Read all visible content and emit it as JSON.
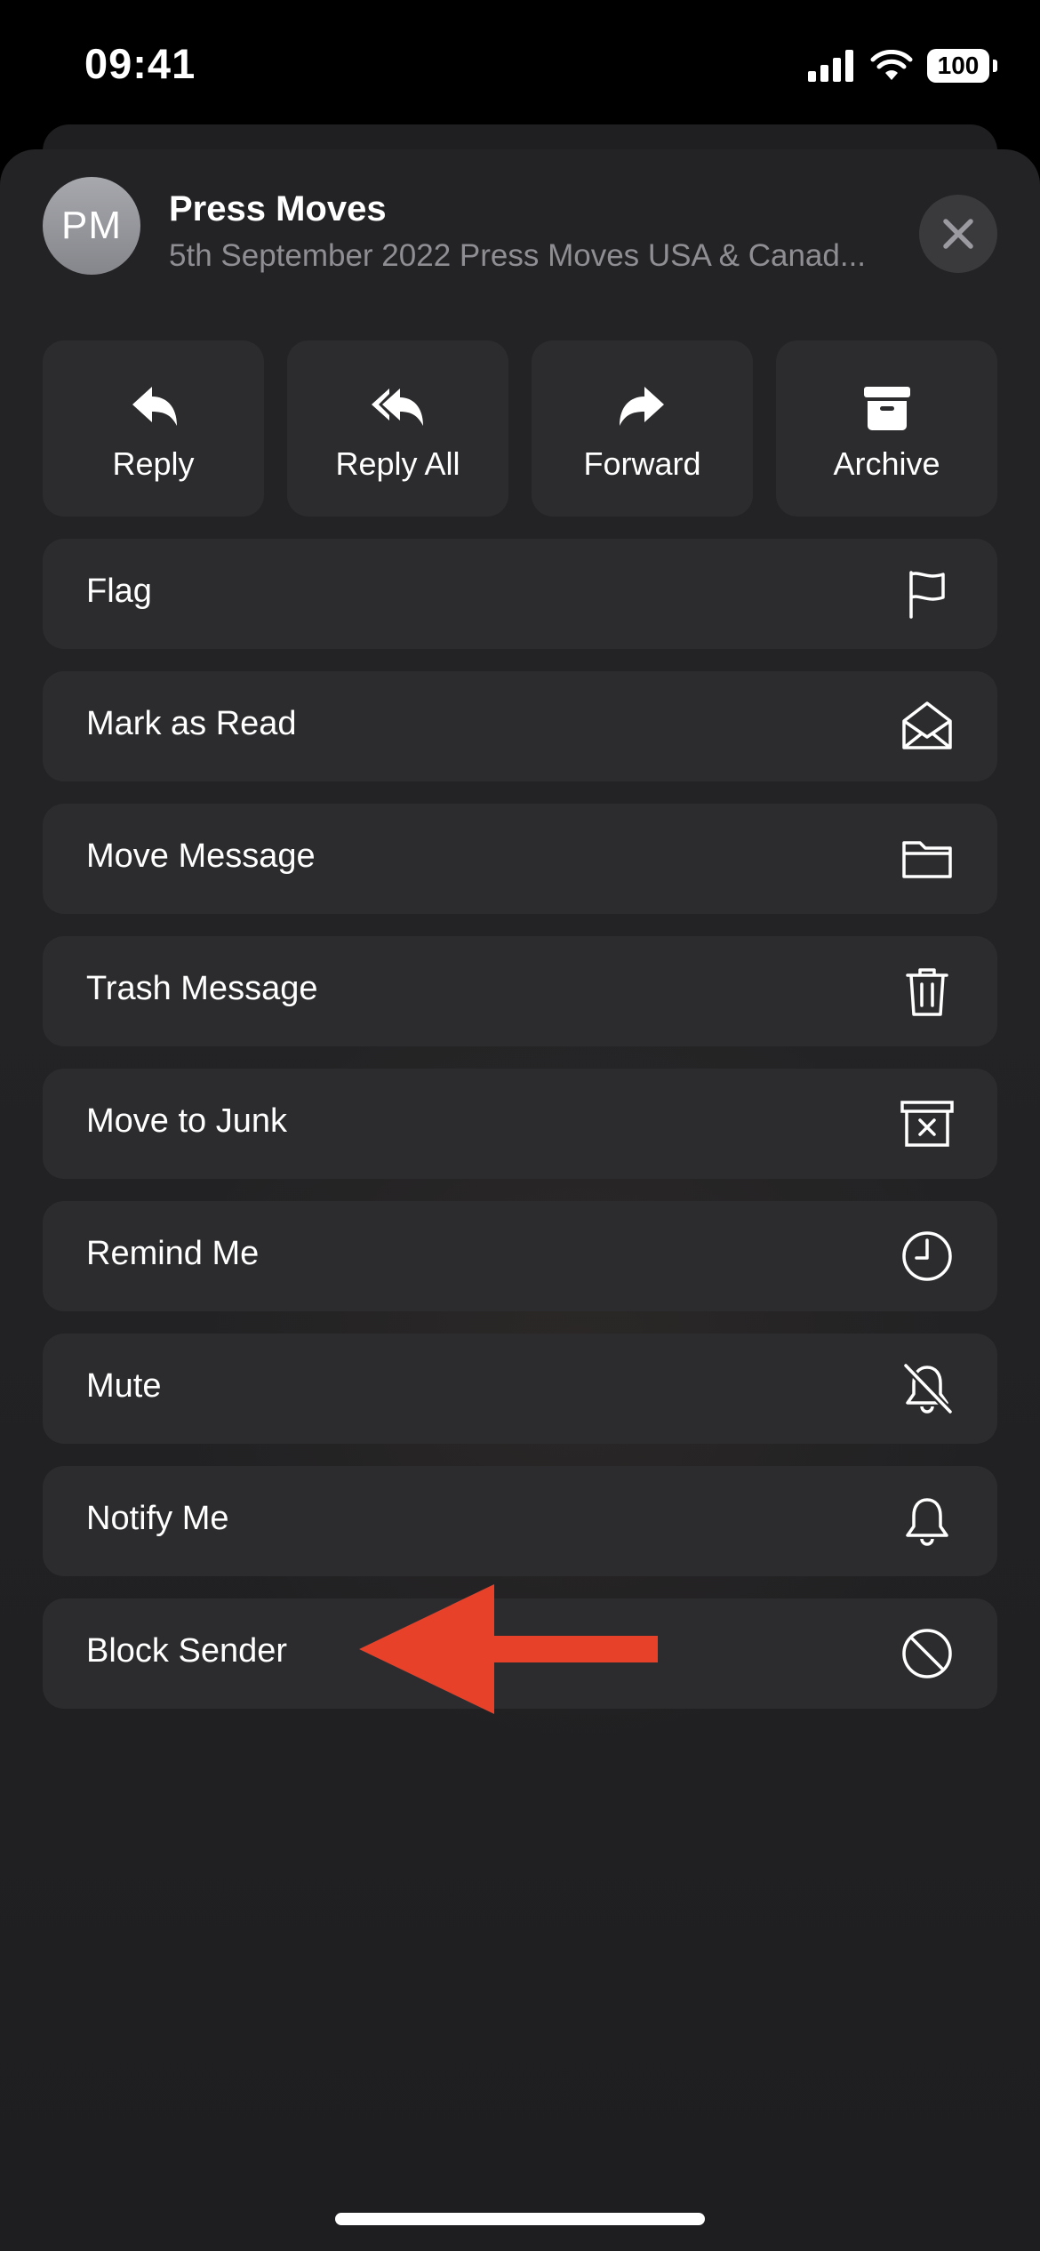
{
  "status_bar": {
    "time": "09:41",
    "battery": "100"
  },
  "header": {
    "avatar_initials": "PM",
    "sender": "Press Moves",
    "subject": "5th September 2022 Press Moves USA & Canad..."
  },
  "actions": [
    {
      "label": "Reply",
      "icon": "reply-icon"
    },
    {
      "label": "Reply All",
      "icon": "reply-all-icon"
    },
    {
      "label": "Forward",
      "icon": "forward-icon"
    },
    {
      "label": "Archive",
      "icon": "archive-icon"
    }
  ],
  "menu": [
    {
      "label": "Flag",
      "icon": "flag-icon"
    },
    {
      "label": "Mark as Read",
      "icon": "open-envelope-icon"
    },
    {
      "label": "Move Message",
      "icon": "folder-icon"
    },
    {
      "label": "Trash Message",
      "icon": "trash-icon"
    },
    {
      "label": "Move to Junk",
      "icon": "junk-bin-icon"
    },
    {
      "label": "Remind Me",
      "icon": "clock-icon"
    },
    {
      "label": "Mute",
      "icon": "bell-slash-icon"
    },
    {
      "label": "Notify Me",
      "icon": "bell-icon"
    },
    {
      "label": "Block Sender",
      "icon": "block-icon"
    }
  ],
  "colors": {
    "sheet": "#232325",
    "row": "#2c2c2e",
    "annotation_arrow": "#e8412a"
  }
}
